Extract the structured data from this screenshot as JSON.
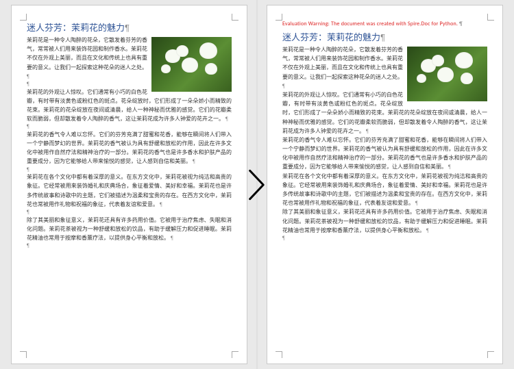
{
  "doc": {
    "title": "迷人芬芳：茉莉花的魅力",
    "warning": "Evaluation Warning: The document was created with Spire.Doc for Python.",
    "pilcrow": "¶",
    "paragraphs": [
      "茉莉花是一种令人陶醉的花朵，它散发着芬芳的香气，常常被人们用来装饰花园和制作香水。茉莉花不仅在外观上美丽，而且在文化和传统上也具有重要的意义。让我们一起探索这种花朵的迷人之处。",
      "茉莉花的外观让人惊叹。它们通常有小巧的白色花瓣，有时带有淡黄色或粉红色的斑点。花朵绽放时，它们形成了一朵朵娇小而精致的花束。茉莉花的花朵绽放在夜间或清晨，给人一种神秘而优雅的感觉。它们的花瓣柔软而脆弱，但却散发着令人陶醉的香气，这让茉莉花成为许多人钟爱的花卉之一。",
      "茉莉花的香气令人难以忘怀。它们的芬芳充满了甜蜜和花香，能够在瞬间将人们带入一个宁静而梦幻的世界。茉莉花的香气被认为具有舒缓和放松的作用，因此在许多文化中被用作自然疗法和精神治疗的一部分。茉莉花的香气也是许多香水和护肤产品的重要成分，因为它能够给人带来愉悦的感觉，让人感到自信和美丽。",
      "茉莉花在各个文化中都有着深厚的意义。在东方文化中，茉莉花被视为纯洁和高贵的象征。它经常被用来装饰婚礼和庆典场合，象征着爱情、美好和幸福。茉莉花也是许多传统故事和诗歌中的主题，它们被描述为温柔和宝贵的存在。在西方文化中，茉莉花也常被用作礼物和祝福的象征，代表着友谊和爱意。",
      "除了其美丽和象征意义，茉莉花还具有许多药用价值。它被用于治疗焦虑、失眠和消化问题。茉莉花茶被视为一种舒缓和放松的饮品，有助于缓解压力和促进睡眠。茉莉花精油也常用于按摩和香薰疗法，以提供身心平衡和放松。"
    ]
  }
}
